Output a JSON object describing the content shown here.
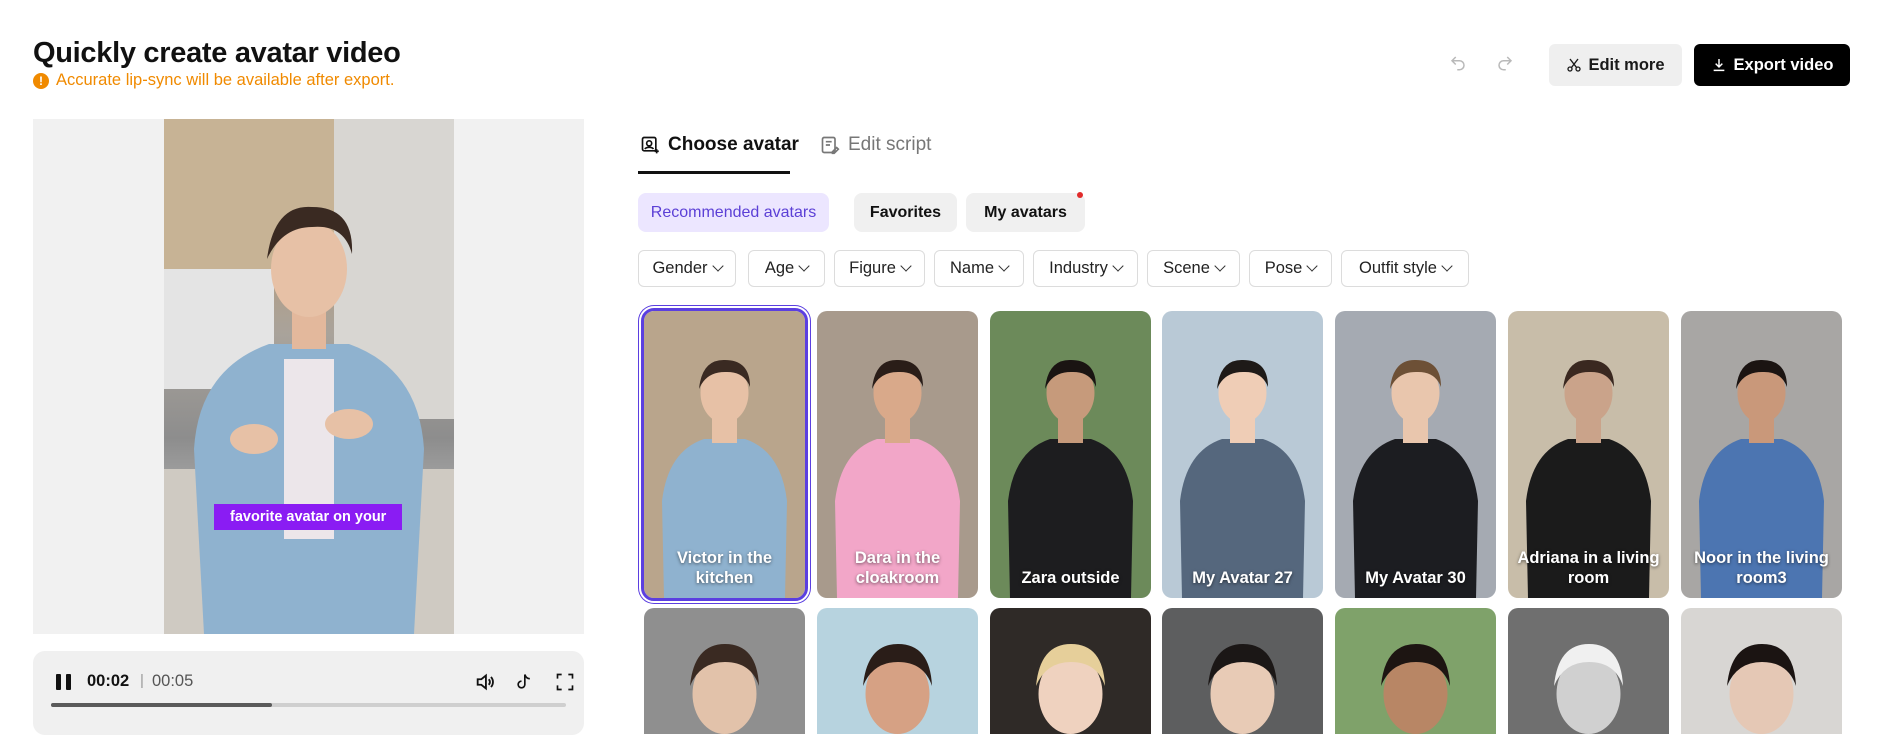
{
  "page": {
    "title": "Quickly create avatar video",
    "warning": "Accurate lip-sync will be available after export."
  },
  "toolbar": {
    "edit_more": "Edit more",
    "export_video": "Export video"
  },
  "preview": {
    "caption": "favorite avatar on your"
  },
  "player": {
    "current_time": "00:02",
    "separator": "|",
    "total_time": "00:05",
    "progress_fraction": 0.43
  },
  "tabs": [
    {
      "label": "Choose avatar",
      "active": true
    },
    {
      "label": "Edit script",
      "active": false
    }
  ],
  "categories": [
    {
      "label": "Recommended avatars",
      "active": true
    },
    {
      "label": "Favorites",
      "active": false
    },
    {
      "label": "My avatars",
      "active": false,
      "has_notification": true
    }
  ],
  "filters": [
    "Gender",
    "Age",
    "Figure",
    "Name",
    "Industry",
    "Scene",
    "Pose",
    "Outfit style"
  ],
  "avatars_row1": [
    {
      "label": "Victor in the kitchen",
      "selected": true,
      "bg": "#b9a58c"
    },
    {
      "label": "Dara in the cloakroom",
      "selected": false,
      "bg": "#a89a8c"
    },
    {
      "label": "Zara outside",
      "selected": false,
      "bg": "#6c8a5a"
    },
    {
      "label": "My Avatar 27",
      "selected": false,
      "bg": "#b9c9d6"
    },
    {
      "label": "My Avatar 30",
      "selected": false,
      "bg": "#a5aab2"
    },
    {
      "label": "Adriana in a living room",
      "selected": false,
      "bg": "#c8bda9"
    },
    {
      "label": "Noor in the living room3",
      "selected": false,
      "bg": "#a8a6a4"
    }
  ],
  "avatars_row2": [
    {
      "bg": "#8f8f8f"
    },
    {
      "bg": "#b7d3df"
    },
    {
      "bg": "#2f2a27"
    },
    {
      "bg": "#5d5e5f"
    },
    {
      "bg": "#7fa26a"
    },
    {
      "bg": "#6f6f6f"
    },
    {
      "bg": "#d8d6d3"
    }
  ],
  "colors": {
    "accent": "#5b3fe0",
    "warning": "#f08a00",
    "caption_bg": "#8a1cf3"
  }
}
